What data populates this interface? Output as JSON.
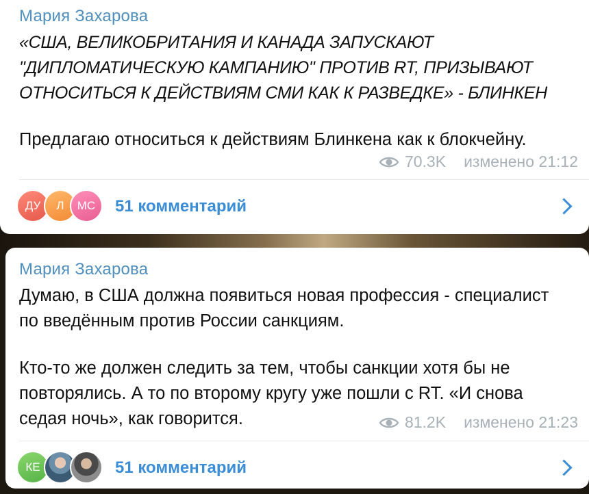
{
  "posts": [
    {
      "sender": "Мария Захарова",
      "quote_lines": [
        "«США, ВЕЛИКОБРИТАНИЯ И КАНАДА ЗАПУСКАЮТ",
        "\"ДИПЛОМАТИЧЕСКУЮ КАМПАНИЮ\" ПРОТИВ RT, ПРИЗЫВАЮТ",
        "ОТНОСИТЬСЯ К ДЕЙСТВИЯМ СМИ КАК К РАЗВЕДКЕ» - БЛИНКЕН"
      ],
      "text": "Предлагаю относиться к действиям Блинкена как к блокчейну.",
      "views": "70.3K",
      "edited_time": "изменено 21:12",
      "comments_label": "51 комментарий",
      "avatars": [
        "ДУ",
        "Л",
        "МС"
      ]
    },
    {
      "sender": "Мария Захарова",
      "text_lines": [
        "Думаю, в США должна появиться новая профессия - специалист",
        "по введённым против России санкциям."
      ],
      "text2_lines": [
        "Кто-то же должен следить за тем, чтобы санкции  хотя бы не",
        "повторялись. А то по второму кругу уже пошли с RT. «И снова",
        "седая ночь», как говорится."
      ],
      "views": "81.2K",
      "edited_time": "изменено 21:23",
      "comments_label": "51 комментарий",
      "avatars": [
        "КЕ"
      ]
    }
  ],
  "icons": {
    "views": "eye-icon",
    "open_comments": "chevron-right-icon"
  },
  "colors": {
    "sender": "#4f8fbd",
    "link": "#3b8ed6",
    "meta": "#a8b1b8"
  }
}
